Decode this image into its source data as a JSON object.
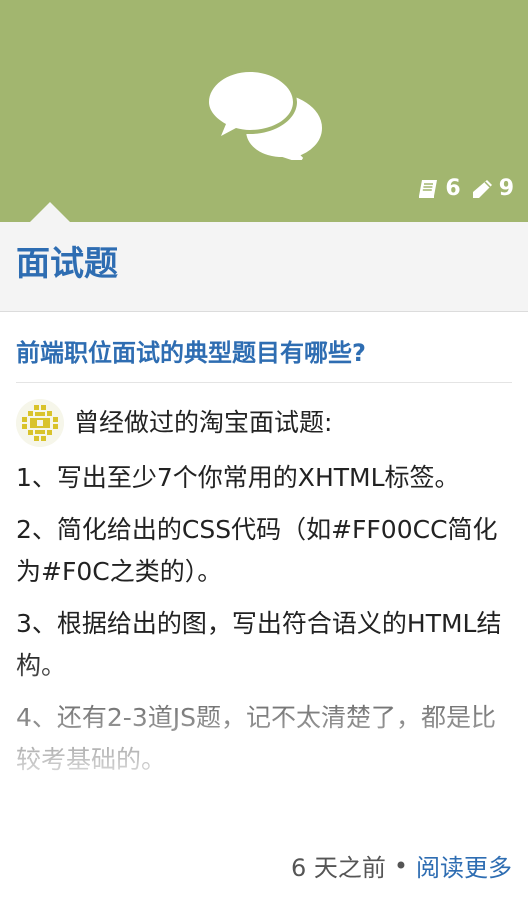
{
  "banner": {
    "bg_color": "#a2b66f",
    "icon": "chat-bubbles-icon",
    "stats": {
      "topics_icon": "book-icon",
      "topics_count": "6",
      "posts_icon": "pencil-icon",
      "posts_count": "9"
    }
  },
  "category": {
    "title": "面试题"
  },
  "topic": {
    "title": "前端职位面试的典型题目有哪些?",
    "author_line": "曾经做过的淘宝面试题:",
    "paragraphs": [
      "1、写出至少7个你常用的XHTML标签。",
      "2、简化给出的CSS代码（如#FF00CC简化为#F0C之类的）。",
      "3、根据给出的图，写出符合语义的HTML结构。",
      "4、还有2-3道JS题，记不太清楚了，都是比较考基础的。"
    ],
    "time_ago": "6 天之前",
    "separator": "•",
    "read_more": "阅读更多"
  },
  "colors": {
    "accent": "#2e6db2",
    "banner": "#a2b66f"
  }
}
